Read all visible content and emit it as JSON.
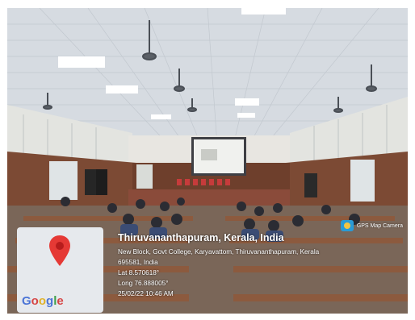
{
  "watermark": {
    "app_name": "GPS Map Camera",
    "icon": "gps-map-camera-icon"
  },
  "map": {
    "provider": "Google",
    "pin_icon": "location-pin-icon"
  },
  "location": {
    "place": "Thiruvananthapuram, Kerala, India",
    "address_line1": "New Block, Govt College, Karyavattom, Thiruvananthapuram, Kerala",
    "address_line2": "695581, India",
    "latitude": "Lat 8.570618°",
    "longitude": "Long 76.888005°",
    "timestamp": "25/02/22 10:46 AM"
  }
}
